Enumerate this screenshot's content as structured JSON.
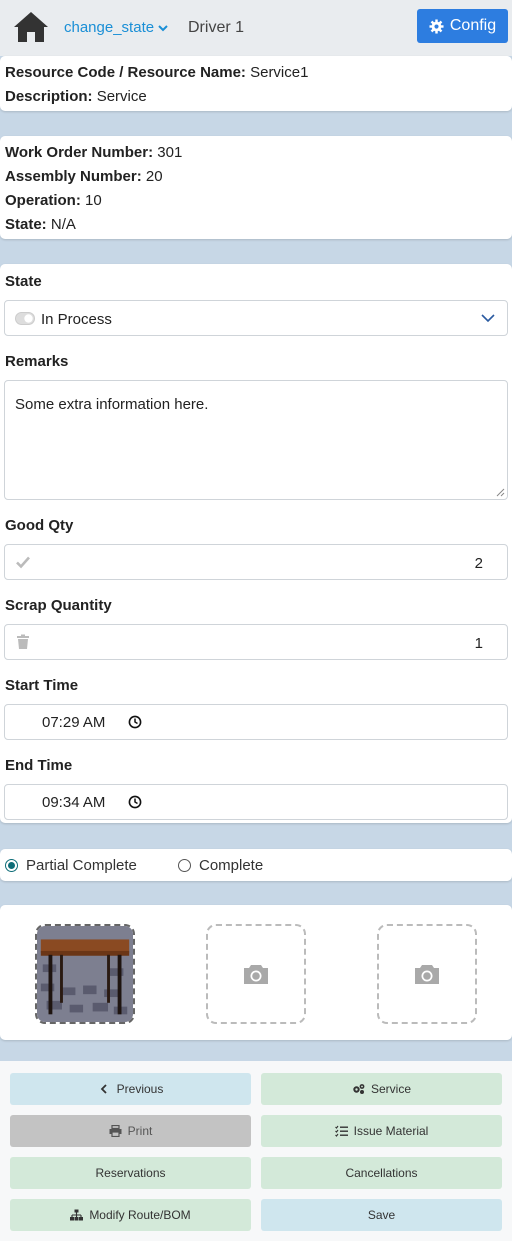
{
  "header": {
    "home_icon": "home-icon",
    "app_link_label": "change_state",
    "title": "Driver 1",
    "config_label": "Config"
  },
  "resource": {
    "code_label": "Resource Code / Resource Name:",
    "code_value": "Service1",
    "desc_label": "Description:",
    "desc_value": "Service"
  },
  "work_order": {
    "wo_label": "Work Order Number:",
    "wo_value": "301",
    "assembly_label": "Assembly Number:",
    "assembly_value": "20",
    "operation_label": "Operation:",
    "operation_value": "10",
    "state_label": "State:",
    "state_value": "N/A"
  },
  "form": {
    "state_label": "State",
    "state_value": "In Process",
    "remarks_label": "Remarks",
    "remarks_value": "Some extra information here.",
    "good_qty_label": "Good Qty",
    "good_qty_value": "2",
    "scrap_label": "Scrap Quantity",
    "scrap_value": "1",
    "start_label": "Start Time",
    "start_value": "07:29  AM",
    "end_label": "End Time",
    "end_value": "09:34  AM"
  },
  "completion": {
    "partial_label": "Partial Complete",
    "complete_label": "Complete",
    "selected": "partial"
  },
  "photos": {
    "slot_icon": "camera-icon"
  },
  "footer": {
    "previous": "Previous",
    "service": "Service",
    "print": "Print",
    "issue_material": "Issue Material",
    "reservations": "Reservations",
    "cancellations": "Cancellations",
    "modify_route": "Modify Route/BOM",
    "save": "Save"
  },
  "colors": {
    "background": "#c7d7e6",
    "accent": "#2d7de0",
    "link": "#1a8fd6",
    "radio_selected": "#0e6d78"
  }
}
